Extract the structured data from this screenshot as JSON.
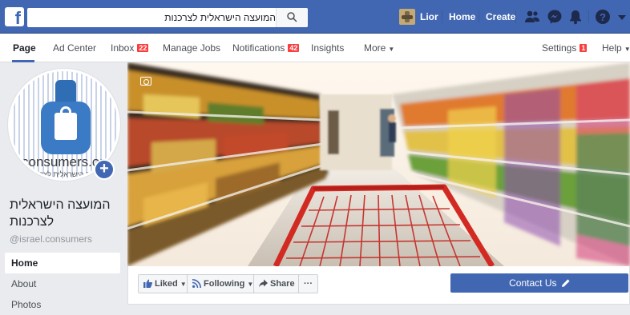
{
  "topbar": {
    "logo": "f",
    "search_value": "המועצה הישראלית לצרכנות",
    "user_name": "Lior",
    "home_label": "Home",
    "create_label": "Create",
    "icons": [
      "friends-icon",
      "messenger-icon",
      "notifications-bell-icon",
      "help-icon",
      "account-menu-icon"
    ]
  },
  "pagebar": {
    "items": [
      {
        "label": "Page"
      },
      {
        "label": "Ad Center"
      },
      {
        "label": "Inbox",
        "badge": "22"
      },
      {
        "label": "Manage Jobs"
      },
      {
        "label": "Notifications",
        "badge": "42"
      },
      {
        "label": "Insights"
      },
      {
        "label": "More"
      }
    ],
    "settings_label": "Settings",
    "settings_badge": "1",
    "help_label": "Help"
  },
  "profile": {
    "logo_text": "consumers.org",
    "logo_subtext": "המועצה הישראלית לצרכנות",
    "page_name": "המועצה הישראלית לצרכנות",
    "handle": "@israel.consumers"
  },
  "left_nav": [
    {
      "label": "Home"
    },
    {
      "label": "About"
    },
    {
      "label": "Photos"
    }
  ],
  "actions": {
    "liked_label": "Liked",
    "following_label": "Following",
    "share_label": "Share",
    "more_label": "···",
    "contact_label": "Contact Us"
  },
  "colors": {
    "brand_blue": "#4267b2",
    "badge_red": "#fa3e3e",
    "cart_red": "#d22a22"
  }
}
